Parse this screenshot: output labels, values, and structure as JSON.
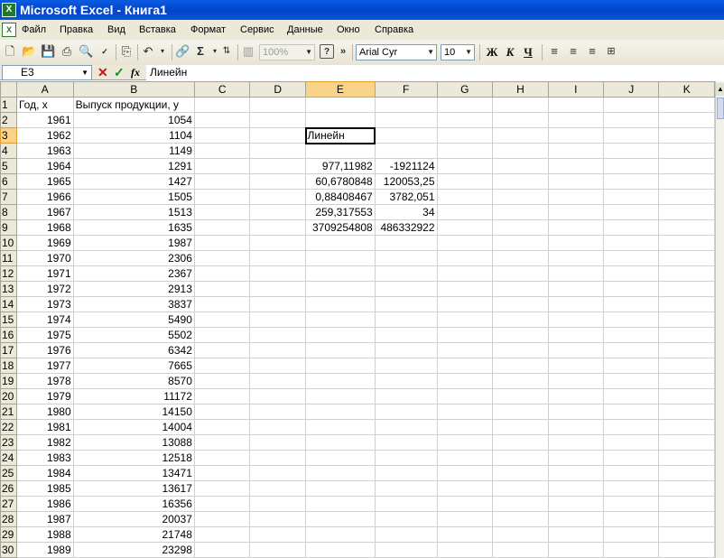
{
  "window": {
    "title": "Microsoft Excel - Книга1"
  },
  "menu": [
    "Файл",
    "Правка",
    "Вид",
    "Вставка",
    "Формат",
    "Сервис",
    "Данные",
    "Окно",
    "Справка"
  ],
  "toolbar": {
    "zoom": "100%",
    "font": "Arial Cyr",
    "size": "10",
    "bold": "Ж",
    "italic": "К",
    "underline": "Ч",
    "sigma": "Σ",
    "more": "»"
  },
  "formula_bar": {
    "cell_ref": "E3",
    "content": "Линейн",
    "fx": "fx"
  },
  "columns": [
    "A",
    "B",
    "C",
    "D",
    "E",
    "F",
    "G",
    "H",
    "I",
    "J",
    "K"
  ],
  "rows": [
    [
      "Год, x",
      "Выпуск продукции, y",
      "",
      "",
      "",
      ""
    ],
    [
      "1961",
      "1054",
      "",
      "",
      "",
      ""
    ],
    [
      "1962",
      "1104",
      "",
      "",
      "Линейн",
      ""
    ],
    [
      "1963",
      "1149",
      "",
      "",
      "",
      ""
    ],
    [
      "1964",
      "1291",
      "",
      "",
      "977,11982",
      "-1921124"
    ],
    [
      "1965",
      "1427",
      "",
      "",
      "60,6780848",
      "120053,25"
    ],
    [
      "1966",
      "1505",
      "",
      "",
      "0,88408467",
      "3782,051"
    ],
    [
      "1967",
      "1513",
      "",
      "",
      "259,317553",
      "34"
    ],
    [
      "1968",
      "1635",
      "",
      "",
      "3709254808",
      "486332922"
    ],
    [
      "1969",
      "1987",
      "",
      "",
      "",
      ""
    ],
    [
      "1970",
      "2306",
      "",
      "",
      "",
      ""
    ],
    [
      "1971",
      "2367",
      "",
      "",
      "",
      ""
    ],
    [
      "1972",
      "2913",
      "",
      "",
      "",
      ""
    ],
    [
      "1973",
      "3837",
      "",
      "",
      "",
      ""
    ],
    [
      "1974",
      "5490",
      "",
      "",
      "",
      ""
    ],
    [
      "1975",
      "5502",
      "",
      "",
      "",
      ""
    ],
    [
      "1976",
      "6342",
      "",
      "",
      "",
      ""
    ],
    [
      "1977",
      "7665",
      "",
      "",
      "",
      ""
    ],
    [
      "1978",
      "8570",
      "",
      "",
      "",
      ""
    ],
    [
      "1979",
      "11172",
      "",
      "",
      "",
      ""
    ],
    [
      "1980",
      "14150",
      "",
      "",
      "",
      ""
    ],
    [
      "1981",
      "14004",
      "",
      "",
      "",
      ""
    ],
    [
      "1982",
      "13088",
      "",
      "",
      "",
      ""
    ],
    [
      "1983",
      "12518",
      "",
      "",
      "",
      ""
    ],
    [
      "1984",
      "13471",
      "",
      "",
      "",
      ""
    ],
    [
      "1985",
      "13617",
      "",
      "",
      "",
      ""
    ],
    [
      "1986",
      "16356",
      "",
      "",
      "",
      ""
    ],
    [
      "1987",
      "20037",
      "",
      "",
      "",
      ""
    ],
    [
      "1988",
      "21748",
      "",
      "",
      "",
      ""
    ],
    [
      "1989",
      "23298",
      "",
      "",
      "",
      ""
    ]
  ]
}
